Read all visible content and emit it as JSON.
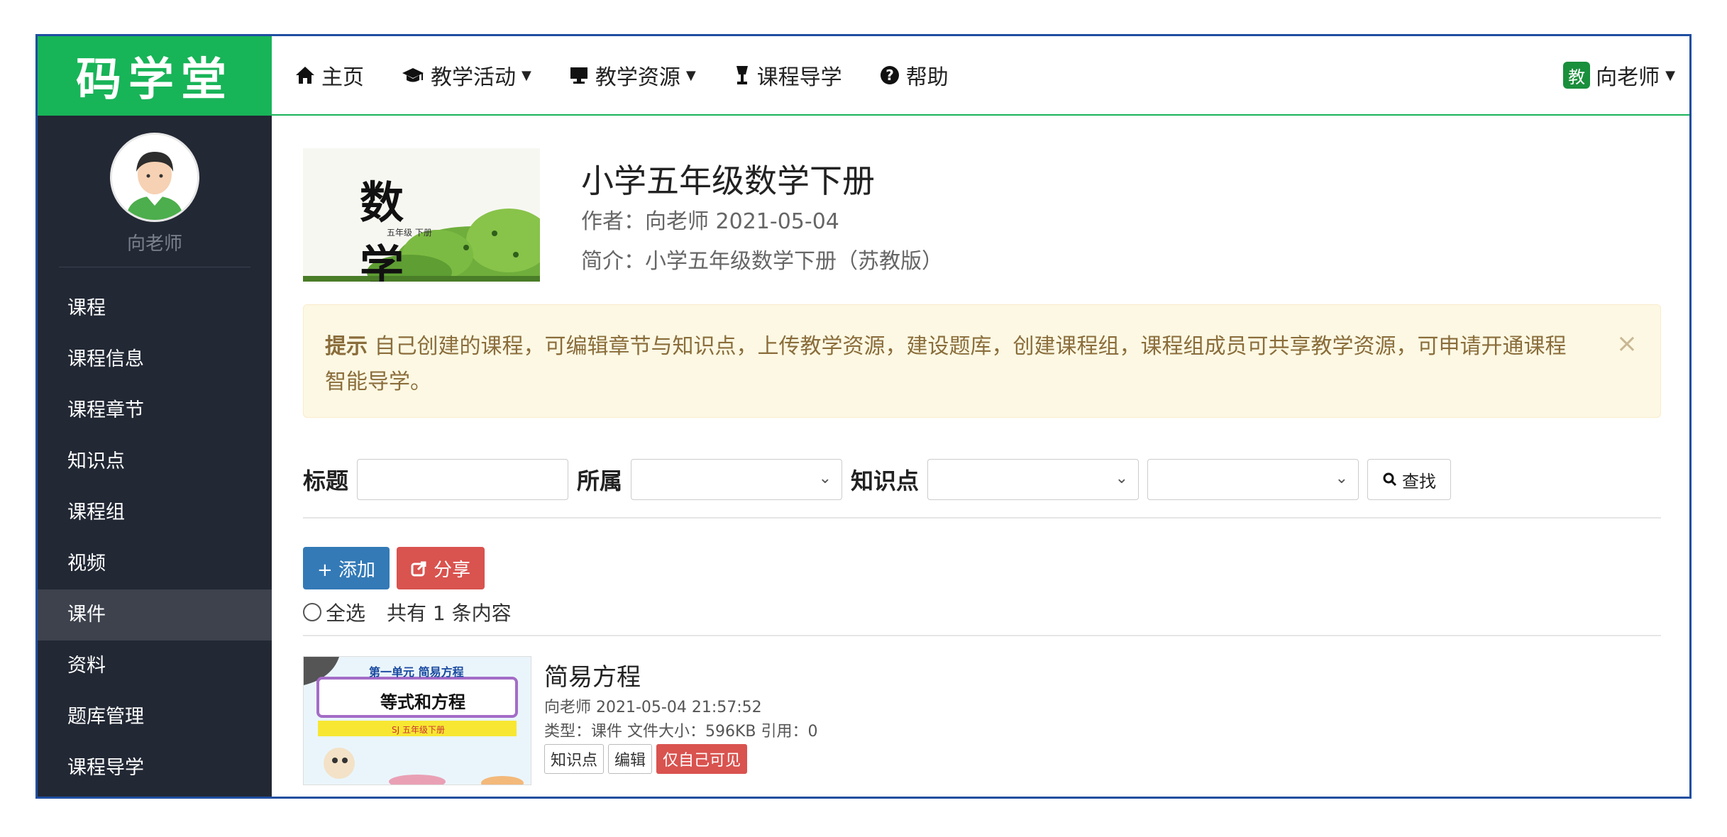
{
  "brand": {
    "logo_text": "码学堂"
  },
  "profile": {
    "name": "向老师"
  },
  "sidebar": {
    "items": [
      {
        "label": "课程"
      },
      {
        "label": "课程信息"
      },
      {
        "label": "课程章节"
      },
      {
        "label": "知识点"
      },
      {
        "label": "课程组"
      },
      {
        "label": "视频"
      },
      {
        "label": "课件"
      },
      {
        "label": "资料"
      },
      {
        "label": "题库管理"
      },
      {
        "label": "课程导学"
      }
    ],
    "active_index": 6
  },
  "topnav": {
    "items": [
      {
        "label": "主页",
        "icon": "home-icon"
      },
      {
        "label": "教学活动",
        "icon": "graduation-cap-icon",
        "dropdown": true
      },
      {
        "label": "教学资源",
        "icon": "monitor-icon",
        "dropdown": true
      },
      {
        "label": "课程导学",
        "icon": "lamp-icon"
      },
      {
        "label": "帮助",
        "icon": "question-circle-icon"
      }
    ],
    "user": {
      "badge": "教",
      "name": "向老师"
    }
  },
  "course": {
    "cover_title": "数 学",
    "cover_subtitle": "五年级 下册",
    "title": "小学五年级数学下册",
    "meta": "作者：向老师 2021-05-04",
    "desc": "简介：小学五年级数学下册（苏教版）"
  },
  "alert": {
    "strong": "提示",
    "text": " 自己创建的课程，可编辑章节与知识点，上传教学资源，建设题库，创建课程组，课程组成员可共享教学资源，可申请开通课程智能导学。",
    "close": "×"
  },
  "filter": {
    "title_label": "标题",
    "belong_label": "所属",
    "knowledge_label": "知识点",
    "search_label": "查找"
  },
  "actions": {
    "add_label": "+ 添加",
    "share_label": "分享",
    "select_all": "全选",
    "count_text": "共有 1 条内容"
  },
  "items": [
    {
      "title": "简易方程",
      "meta": "向老师 2021-05-04 21:57:52",
      "info": "类型：课件 文件大小：596KB 引用：0",
      "thumb_unit": "第一单元  简易方程",
      "thumb_title": "等式和方程",
      "thumb_sub": "SJ 五年级下册",
      "tags": [
        "知识点",
        "编辑",
        "仅自己可见"
      ]
    }
  ],
  "colors": {
    "brand_green": "#18b458",
    "sidebar_bg": "#222834",
    "primary": "#337ab7",
    "danger": "#d9534f",
    "alert_bg": "#fcf8e3"
  }
}
